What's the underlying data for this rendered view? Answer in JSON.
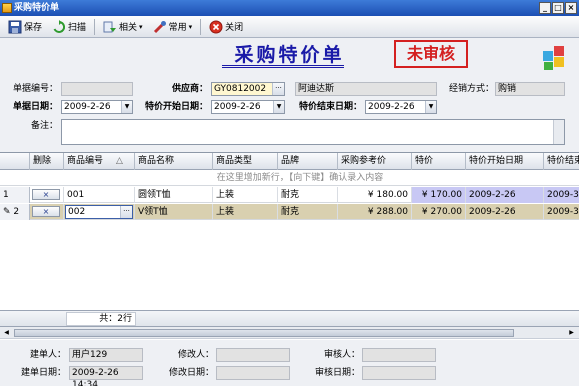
{
  "window": {
    "title": "采购特价单",
    "minimize": "_",
    "maximize": "□",
    "close": "×"
  },
  "toolbar": {
    "save": "保存",
    "scan": "扫描",
    "related": "相关",
    "common": "常用",
    "close": "关闭"
  },
  "header": {
    "title": "采购特价单",
    "stamp": "未审核"
  },
  "form": {
    "doc_no_label": "单据编号：",
    "doc_no_value": "",
    "supplier_label": "供应商：",
    "supplier_code": "GY0812002",
    "supplier_name": "阿迪达斯",
    "sales_mode_label": "经销方式：",
    "sales_mode_value": "购销",
    "doc_date_label": "单据日期：",
    "doc_date_value": "2009-2-26",
    "start_date_label": "特价开始日期：",
    "start_date_value": "2009-2-26",
    "end_date_label": "特价结束日期：",
    "end_date_value": "2009-2-26",
    "remarks_label": "备注：",
    "remarks_value": ""
  },
  "grid": {
    "columns": [
      "删除",
      "商品编号",
      "商品名称",
      "商品类型",
      "品牌",
      "采购参考价",
      "特价",
      "特价开始日期",
      "特价结束"
    ],
    "new_row_hint": "在这里增加新行，【向下键】确认录入内容",
    "delete_label": "×",
    "rows": [
      {
        "index": "1",
        "code": "001",
        "name": "圆领T恤",
        "type": "上装",
        "brand": "耐克",
        "ref_price": "¥ 180.00",
        "special": "¥ 170.00",
        "start": "2009-2-26",
        "end": "2009-3-"
      },
      {
        "index": "2",
        "code": "002",
        "name": "V领T恤",
        "type": "上装",
        "brand": "耐克",
        "ref_price": "¥ 288.00",
        "special": "¥ 270.00",
        "start": "2009-2-26",
        "end": "2009-3-"
      }
    ],
    "total": "共：2行"
  },
  "audit": {
    "creator_label": "建单人：",
    "creator_value": "用户129",
    "modifier_label": "修改人：",
    "modifier_value": "",
    "reviewer_label": "审核人：",
    "reviewer_value": "",
    "create_date_label": "建单日期：",
    "create_date_value": "2009-2-26 14:34",
    "modify_date_label": "修改日期：",
    "modify_date_value": "",
    "review_date_label": "审核日期：",
    "review_date_value": ""
  },
  "colors": {
    "title_blue": "#1a1aa8",
    "stamp_red": "#d42020",
    "special_price_bg": "#c8c8f4",
    "selected_row_bg": "#d9d0b0"
  }
}
